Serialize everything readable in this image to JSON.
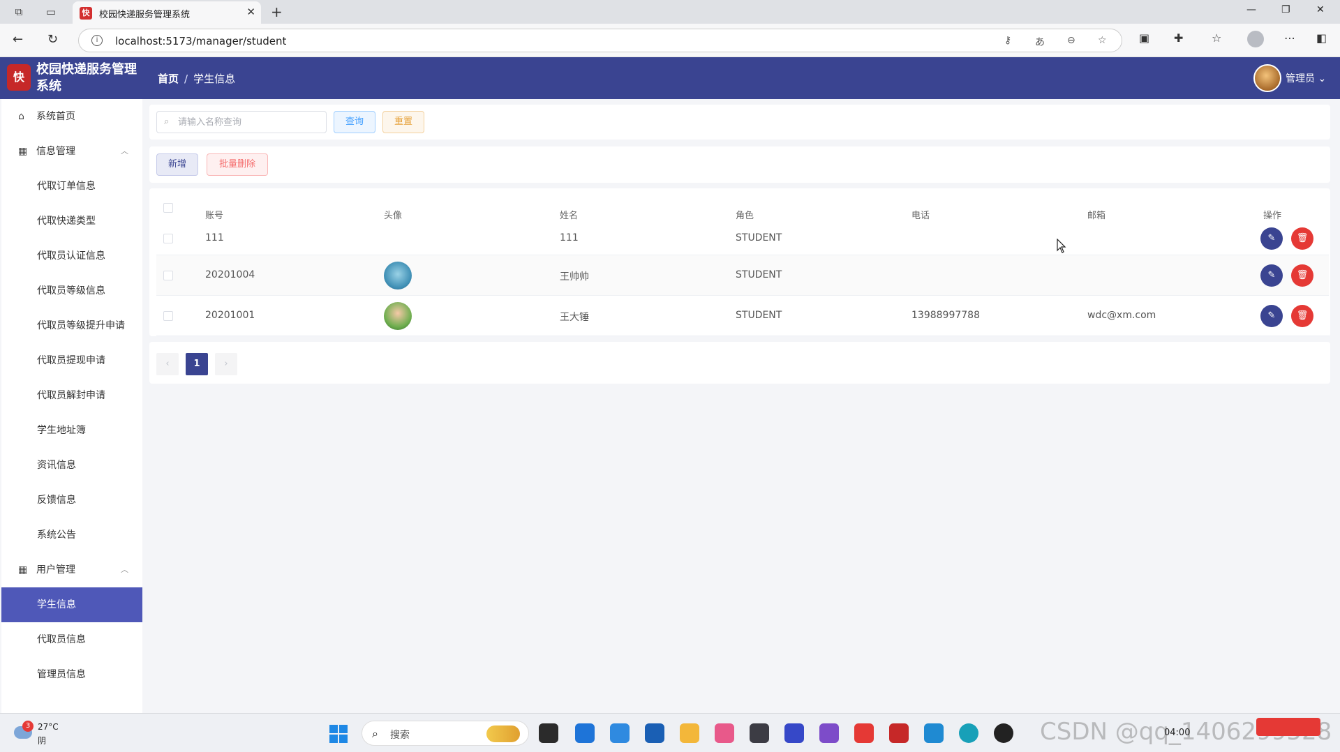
{
  "browser": {
    "tab_title": "校园快递服务管理系统",
    "url": "localhost:5173/manager/student"
  },
  "header": {
    "title": "校园快递服务管理系统",
    "breadcrumb_home": "首页",
    "breadcrumb_separator": "/",
    "breadcrumb_current": "学生信息",
    "user_name": "管理员"
  },
  "sidebar": {
    "home": "系统首页",
    "info_group": "信息管理",
    "info_items": [
      "代取订单信息",
      "代取快递类型",
      "代取员认证信息",
      "代取员等级信息",
      "代取员等级提升申请",
      "代取员提现申请",
      "代取员解封申请",
      "学生地址簿",
      "资讯信息",
      "反馈信息",
      "系统公告"
    ],
    "user_group": "用户管理",
    "user_items": [
      "学生信息",
      "代取员信息",
      "管理员信息"
    ],
    "active_item": "学生信息"
  },
  "toolbar": {
    "search_placeholder": "请输入名称查询",
    "query_label": "查询",
    "reset_label": "重置",
    "add_label": "新增",
    "batch_delete_label": "批量删除"
  },
  "table": {
    "columns": [
      "账号",
      "头像",
      "姓名",
      "角色",
      "电话",
      "邮箱",
      "操作"
    ],
    "rows": [
      {
        "account": "111",
        "name": "111",
        "role": "STUDENT",
        "phone": "",
        "email": ""
      },
      {
        "account": "20201004",
        "name": "王帅帅",
        "role": "STUDENT",
        "phone": "",
        "email": ""
      },
      {
        "account": "20201001",
        "name": "王大锤",
        "role": "STUDENT",
        "phone": "13988997788",
        "email": "wdc@xm.com"
      }
    ]
  },
  "pagination": {
    "current_page": "1"
  },
  "taskbar": {
    "weather_badge": "3",
    "temperature": "27°C",
    "weather": "阴",
    "search_label": "搜索",
    "clock": "04:00",
    "watermark": "CSDN @qq_1406299528"
  },
  "colors": {
    "header_bg": "#3a4491",
    "active_menu": "#4f58b8",
    "danger": "#e53935"
  }
}
